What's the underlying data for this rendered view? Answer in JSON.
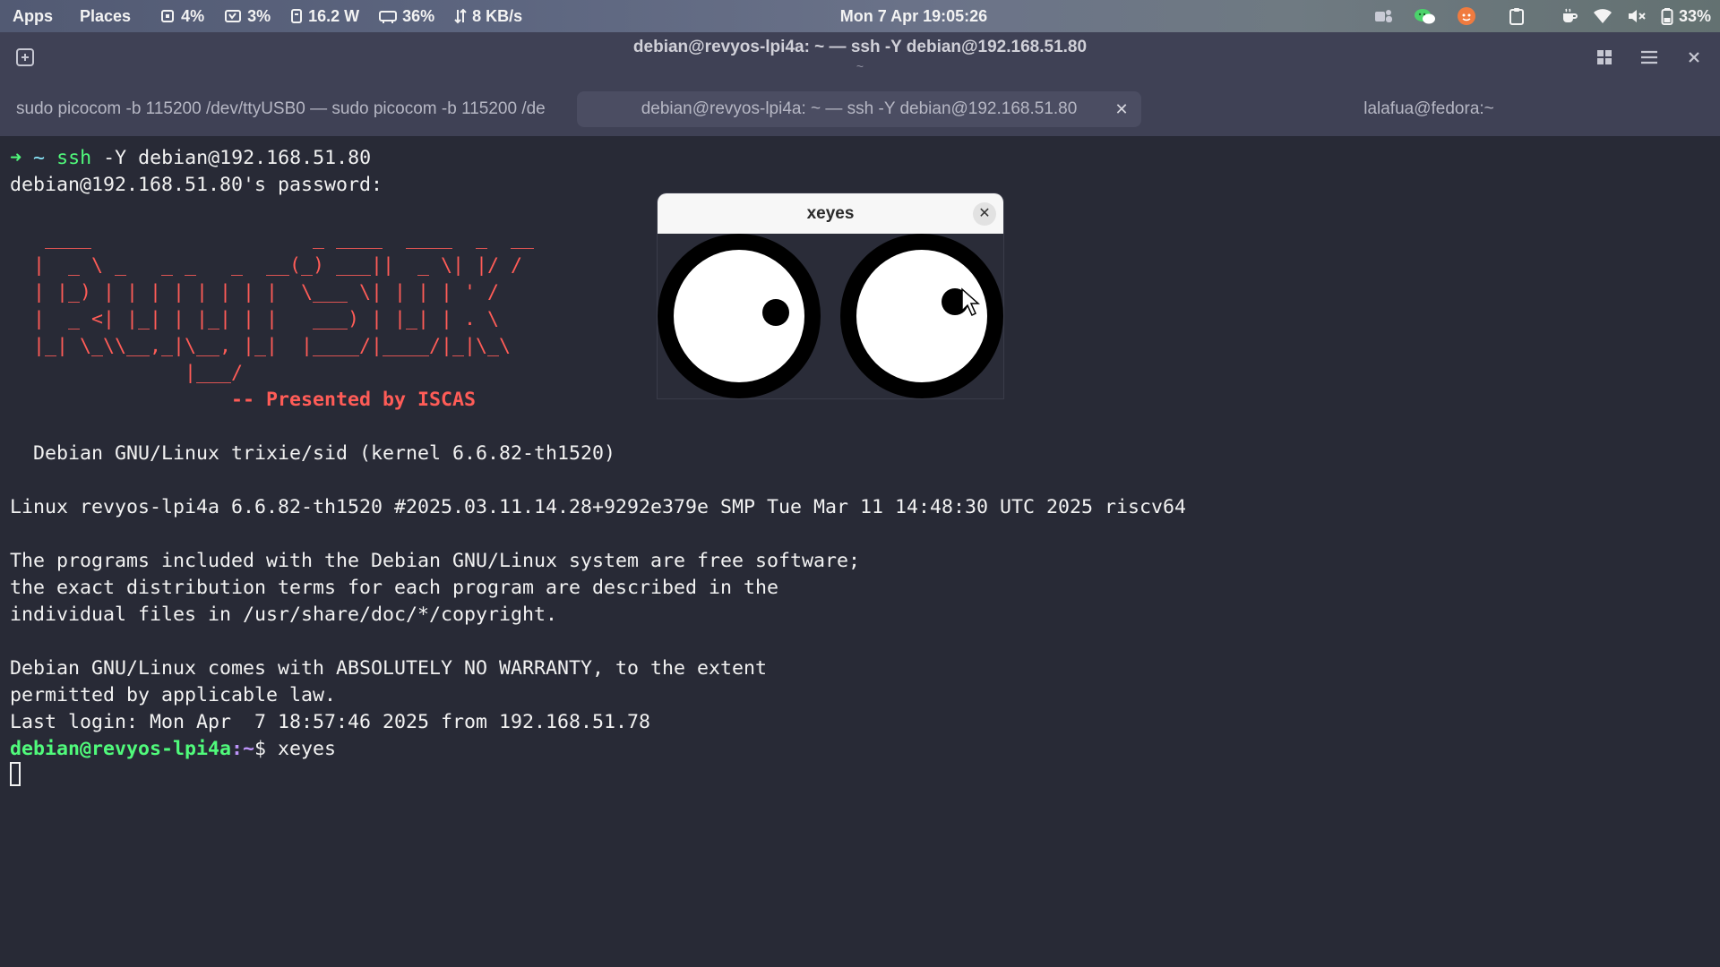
{
  "topbar": {
    "apps": "Apps",
    "places": "Places",
    "cpu": "4%",
    "memory": "3%",
    "power": "16.2 W",
    "gpu": "36%",
    "network": "8 KB/s",
    "clock": "Mon 7 Apr  19:05:26",
    "battery": "33%",
    "icons": [
      "cpu-icon",
      "memory-icon",
      "power-icon",
      "gpu-icon",
      "network-icon",
      "teams-icon",
      "wechat-icon",
      "app-indicator-icon",
      "clipboard-icon",
      "coffee-icon",
      "wifi-icon",
      "volume-muted-icon",
      "battery-icon"
    ]
  },
  "window": {
    "title": "debian@revyos-lpi4a: ~ — ssh -Y debian@192.168.51.80",
    "subtitle": "~"
  },
  "tabs": [
    {
      "label": "sudo picocom -b 115200 /dev/ttyUSB0 — sudo picocom -b 115200 /de",
      "active": false
    },
    {
      "label": "debian@revyos-lpi4a: ~ — ssh -Y debian@192.168.51.80",
      "active": true,
      "close": "✕"
    },
    {
      "label": "lalafua@fedora:~",
      "active": false
    }
  ],
  "terminal": {
    "l1": {
      "arrow": "➜",
      "tilde": "~",
      "cmd": "ssh",
      "args": " -Y debian@192.168.51.80"
    },
    "l2": "debian@192.168.51.80's password:",
    "logo": [
      "   ____                   _ ____  ____  _  __",
      "  |  _ \\ _   _ _   _  __(_) ___||  _ \\| |/ /",
      "  | |_) | | | | | | | |  \\___ \\| | | | ' / ",
      "  |  _ <| |_| | |_| | |   ___) | |_| | . \\ ",
      "  |_| \\_\\\\__,_|\\__, |_|  |____/|____/|_|\\_\\",
      "               |___/"
    ],
    "presented": "                   -- Presented by ISCAS",
    "debian_version": "  Debian GNU/Linux trixie/sid (kernel 6.6.82-th1520)",
    "uname": "Linux revyos-lpi4a 6.6.82-th1520 #2025.03.11.14.28+9292e379e SMP Tue Mar 11 14:48:30 UTC 2025 riscv64",
    "motd1": "The programs included with the Debian GNU/Linux system are free software;",
    "motd2": "the exact distribution terms for each program are described in the",
    "motd3": "individual files in /usr/share/doc/*/copyright.",
    "motd4": "Debian GNU/Linux comes with ABSOLUTELY NO WARRANTY, to the extent",
    "motd5": "permitted by applicable law.",
    "last_login": "Last login: Mon Apr  7 18:57:46 2025 from 192.168.51.78",
    "prompt_user": "debian@revyos-lpi4a",
    "prompt_path": ":~",
    "prompt_cmd": "$ xeyes"
  },
  "xeyes": {
    "title": "xeyes",
    "close": "✕"
  },
  "colors": {
    "terminal_bg": "#282a36",
    "header_bg": "#3f4155",
    "green": "#50fa7b",
    "cyan": "#8be9fd",
    "logo_red": "#ff5c57",
    "purple": "#bd93f9"
  }
}
